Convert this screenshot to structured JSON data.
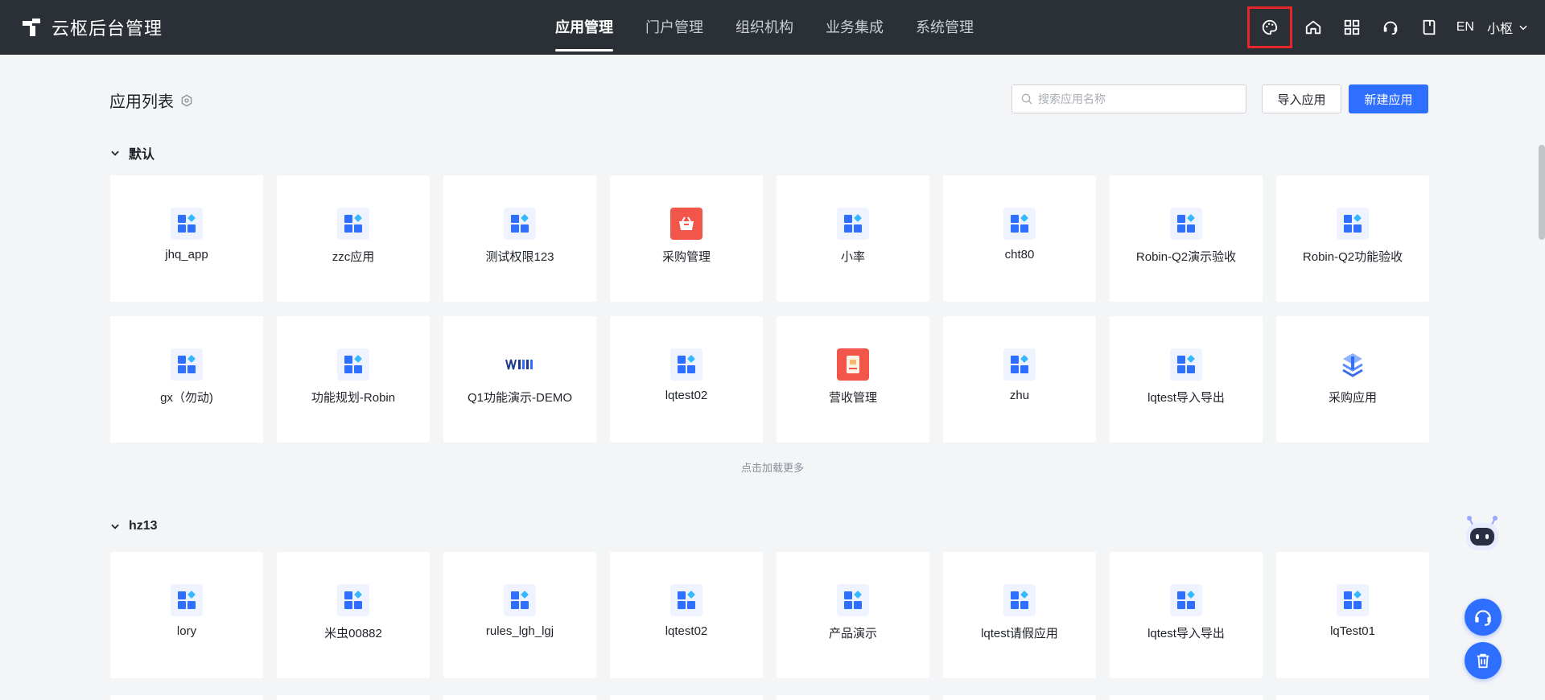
{
  "brand": {
    "name": "云枢后台管理"
  },
  "nav": [
    {
      "label": "应用管理",
      "active": true
    },
    {
      "label": "门户管理",
      "active": false
    },
    {
      "label": "组织机构",
      "active": false
    },
    {
      "label": "业务集成",
      "active": false
    },
    {
      "label": "系统管理",
      "active": false
    }
  ],
  "toolbar": {
    "lang_label": "EN",
    "user_name": "小枢"
  },
  "page": {
    "title": "应用列表",
    "search_placeholder": "搜索应用名称",
    "import_label": "导入应用",
    "new_label": "新建应用"
  },
  "groups": [
    {
      "name": "默认",
      "apps": [
        {
          "label": "jhq_app",
          "icon": "grid-app-icon"
        },
        {
          "label": "zzc应用",
          "icon": "grid-app-icon"
        },
        {
          "label": "测试权限123",
          "icon": "grid-app-icon"
        },
        {
          "label": "采购管理",
          "icon": "basket-icon"
        },
        {
          "label": "小率",
          "icon": "grid-app-icon"
        },
        {
          "label": "cht80",
          "icon": "grid-app-icon"
        },
        {
          "label": "Robin-Q2演示验收",
          "icon": "grid-app-icon"
        },
        {
          "label": "Robin-Q2功能验收",
          "icon": "grid-app-icon"
        },
        {
          "label": "gx（勿动)",
          "icon": "grid-app-icon"
        },
        {
          "label": "功能规划-Robin",
          "icon": "grid-app-icon"
        },
        {
          "label": "Q1功能演示-DEMO",
          "icon": "custom-logo-icon"
        },
        {
          "label": "lqtest02",
          "icon": "grid-app-icon"
        },
        {
          "label": "营收管理",
          "icon": "receipt-icon"
        },
        {
          "label": "zhu",
          "icon": "grid-app-icon"
        },
        {
          "label": "lqtest导入导出",
          "icon": "grid-app-icon"
        },
        {
          "label": "采购应用",
          "icon": "stack-icon"
        }
      ],
      "load_more": "点击加载更多"
    },
    {
      "name": "hz13",
      "apps": [
        {
          "label": "lory",
          "icon": "grid-app-icon"
        },
        {
          "label": "米虫00882",
          "icon": "grid-app-icon"
        },
        {
          "label": "rules_lgh_lgj",
          "icon": "grid-app-icon"
        },
        {
          "label": "lqtest02",
          "icon": "grid-app-icon"
        },
        {
          "label": "产品演示",
          "icon": "grid-app-icon"
        },
        {
          "label": "lqtest请假应用",
          "icon": "grid-app-icon"
        },
        {
          "label": "lqtest导入导出",
          "icon": "grid-app-icon"
        },
        {
          "label": "lqTest01",
          "icon": "grid-app-icon"
        }
      ]
    }
  ],
  "colors": {
    "topbar": "#2b2f36",
    "primary": "#2f6fff",
    "highlight_border": "#e8262a",
    "background": "#f4f5f7"
  }
}
